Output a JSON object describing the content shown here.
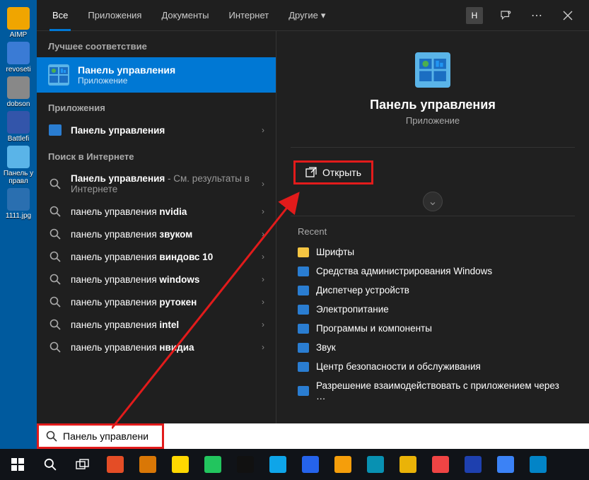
{
  "desktop": [
    {
      "label": "AIMP",
      "color": "#f0a500"
    },
    {
      "label": "revoseti",
      "color": "#3a7bd5"
    },
    {
      "label": "dobson",
      "color": "#888"
    },
    {
      "label": "Battlefi",
      "color": "#3355aa"
    },
    {
      "label": "Панель управл",
      "color": "#5ab4e8"
    },
    {
      "label": "1111.jpg",
      "color": "#2a6fb0"
    }
  ],
  "header": {
    "tabs": [
      "Все",
      "Приложения",
      "Документы",
      "Интернет",
      "Другие"
    ],
    "avatar": "Н"
  },
  "sections": {
    "best": "Лучшее соответствие",
    "apps": "Приложения",
    "web": "Поиск в Интернете"
  },
  "best": {
    "title": "Панель управления",
    "subtitle": "Приложение"
  },
  "apps_items": [
    {
      "label": "Панель управления"
    }
  ],
  "web_items": [
    {
      "prefix": "Панель управления",
      "suffix": " - См. результаты в Интернете"
    },
    {
      "prefix": "панель управления ",
      "bold": "nvidia"
    },
    {
      "prefix": "панель управления ",
      "bold": "звуком"
    },
    {
      "prefix": "панель управления ",
      "bold": "виндовс 10"
    },
    {
      "prefix": "панель управления ",
      "bold": "windows"
    },
    {
      "prefix": "панель управления ",
      "bold": "рутокен"
    },
    {
      "prefix": "панель управления ",
      "bold": "intel"
    },
    {
      "prefix": "панель управления ",
      "bold": "нвидиа"
    }
  ],
  "details": {
    "title": "Панель управления",
    "subtitle": "Приложение",
    "open": "Открыть",
    "recent_label": "Recent",
    "recent": [
      {
        "label": "Шрифты",
        "color": "#f5c542"
      },
      {
        "label": "Средства администрирования Windows",
        "color": "#2a7dd1"
      },
      {
        "label": "Диспетчер устройств",
        "color": "#2a7dd1"
      },
      {
        "label": "Электропитание",
        "color": "#2a7dd1"
      },
      {
        "label": "Программы и компоненты",
        "color": "#2a7dd1"
      },
      {
        "label": "Звук",
        "color": "#2a7dd1"
      },
      {
        "label": "Центр безопасности и обслуживания",
        "color": "#2a7dd1"
      },
      {
        "label": "Разрешение взаимодействовать с приложением через …",
        "color": "#2a7dd1"
      }
    ]
  },
  "search": {
    "value": "Панель управления"
  },
  "taskbar_apps": [
    {
      "color": "#e44d26"
    },
    {
      "color": "#d97706"
    },
    {
      "color": "#ffd700"
    },
    {
      "color": "#22c55e"
    },
    {
      "color": "#111"
    },
    {
      "color": "#0ea5e9"
    },
    {
      "color": "#2563eb"
    },
    {
      "color": "#f59e0b"
    },
    {
      "color": "#0891b2"
    },
    {
      "color": "#eab308"
    },
    {
      "color": "#ef4444"
    },
    {
      "color": "#1e40af"
    },
    {
      "color": "#3b82f6"
    },
    {
      "color": "#0284c7"
    }
  ]
}
